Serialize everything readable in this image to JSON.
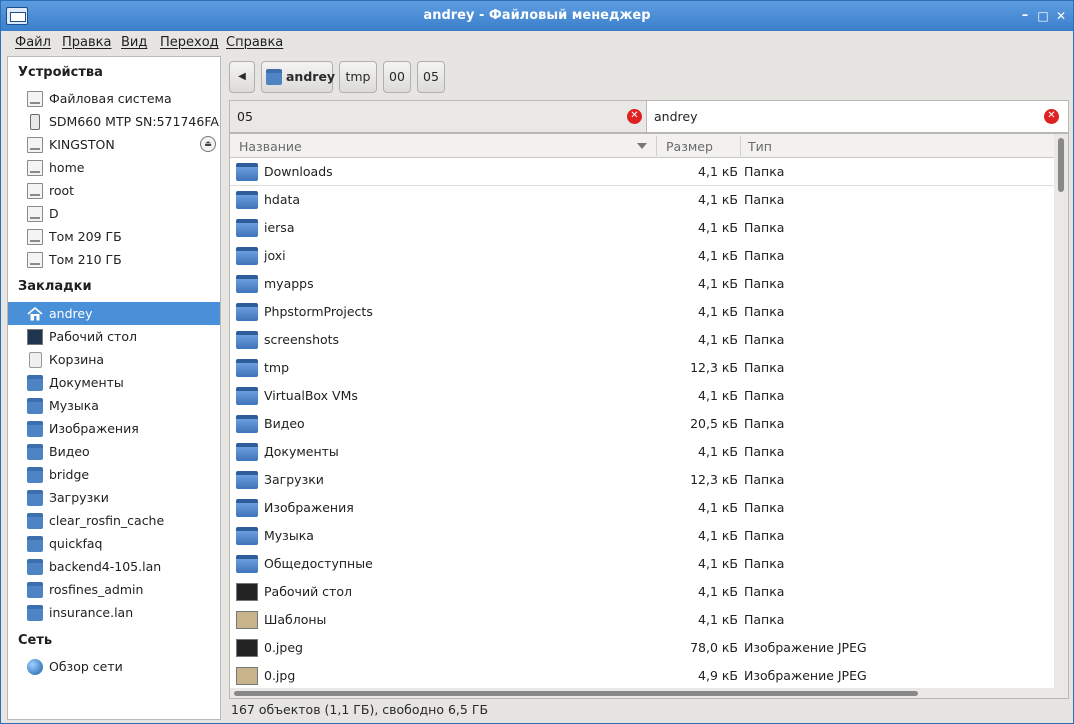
{
  "window": {
    "title": "andrey - Файловый менеджер",
    "controls": {
      "minimize": "–",
      "maximize": "□",
      "close": "✕"
    }
  },
  "menu": [
    "Файл",
    "Правка",
    "Вид",
    "Переход",
    "Справка"
  ],
  "sidebar": {
    "devices_title": "Устройства",
    "devices": [
      {
        "label": "Файловая система",
        "icon": "drive-icon"
      },
      {
        "label": "SDM660 MTP  SN:571746FA",
        "icon": "phone-icon"
      },
      {
        "label": "KINGSTON",
        "icon": "drive-icon",
        "eject": "⏏"
      },
      {
        "label": "home",
        "icon": "drive-icon"
      },
      {
        "label": "root",
        "icon": "drive-icon"
      },
      {
        "label": "D",
        "icon": "drive-icon"
      },
      {
        "label": "Том 209 ГБ",
        "icon": "drive-icon"
      },
      {
        "label": "Том 210 ГБ",
        "icon": "drive-icon"
      }
    ],
    "bookmarks_title": "Закладки",
    "bookmarks": [
      {
        "label": "andrey",
        "icon": "home-icon",
        "selected": true
      },
      {
        "label": "Рабочий стол",
        "icon": "desktop-icon"
      },
      {
        "label": "Корзина",
        "icon": "trash-icon"
      },
      {
        "label": "Документы",
        "icon": "folder-icon"
      },
      {
        "label": "Музыка",
        "icon": "folder-icon"
      },
      {
        "label": "Изображения",
        "icon": "folder-icon"
      },
      {
        "label": "Видео",
        "icon": "folder-icon"
      },
      {
        "label": "bridge",
        "icon": "folder-icon"
      },
      {
        "label": "Загрузки",
        "icon": "folder-icon"
      },
      {
        "label": "clear_rosfin_cache",
        "icon": "folder-icon"
      },
      {
        "label": "quickfaq",
        "icon": "folder-icon"
      },
      {
        "label": "backend4-105.lan",
        "icon": "folder-icon"
      },
      {
        "label": "rosfines_admin",
        "icon": "folder-icon"
      },
      {
        "label": "insurance.lan",
        "icon": "folder-icon"
      }
    ],
    "network_title": "Сеть",
    "network": [
      {
        "label": "Обзор сети",
        "icon": "globe-icon"
      }
    ]
  },
  "pathbar": {
    "back": "◀",
    "crumbs": [
      "andrey",
      "tmp",
      "00",
      "05"
    ]
  },
  "tabs": [
    {
      "label": "05",
      "close": "✕"
    },
    {
      "label": "andrey",
      "close": "✕"
    }
  ],
  "columns": {
    "name": "Название",
    "size": "Размер",
    "type": "Тип"
  },
  "files": [
    {
      "name": "Downloads",
      "size": "4,1 кБ",
      "type": "Папка",
      "icon": "folder-icon"
    },
    {
      "name": "hdata",
      "size": "4,1 кБ",
      "type": "Папка",
      "icon": "folder-icon"
    },
    {
      "name": "iersa",
      "size": "4,1 кБ",
      "type": "Папка",
      "icon": "folder-icon"
    },
    {
      "name": "joxi",
      "size": "4,1 кБ",
      "type": "Папка",
      "icon": "folder-icon"
    },
    {
      "name": "myapps",
      "size": "4,1 кБ",
      "type": "Папка",
      "icon": "folder-icon"
    },
    {
      "name": "PhpstormProjects",
      "size": "4,1 кБ",
      "type": "Папка",
      "icon": "folder-icon"
    },
    {
      "name": "screenshots",
      "size": "4,1 кБ",
      "type": "Папка",
      "icon": "folder-icon"
    },
    {
      "name": "tmp",
      "size": "12,3 кБ",
      "type": "Папка",
      "icon": "folder-icon"
    },
    {
      "name": "VirtualBox VMs",
      "size": "4,1 кБ",
      "type": "Папка",
      "icon": "folder-icon"
    },
    {
      "name": "Видео",
      "size": "20,5 кБ",
      "type": "Папка",
      "icon": "folder-video-icon"
    },
    {
      "name": "Документы",
      "size": "4,1 кБ",
      "type": "Папка",
      "icon": "folder-documents-icon"
    },
    {
      "name": "Загрузки",
      "size": "12,3 кБ",
      "type": "Папка",
      "icon": "folder-downloads-icon"
    },
    {
      "name": "Изображения",
      "size": "4,1 кБ",
      "type": "Папка",
      "icon": "folder-pictures-icon"
    },
    {
      "name": "Музыка",
      "size": "4,1 кБ",
      "type": "Папка",
      "icon": "folder-music-icon"
    },
    {
      "name": "Общедоступные",
      "size": "4,1 кБ",
      "type": "Папка",
      "icon": "folder-public-icon"
    },
    {
      "name": "Рабочий стол",
      "size": "4,1 кБ",
      "type": "Папка",
      "icon": "desktop-icon"
    },
    {
      "name": "Шаблоны",
      "size": "4,1 кБ",
      "type": "Папка",
      "icon": "folder-templates-icon"
    },
    {
      "name": "0.jpeg",
      "size": "78,0 кБ",
      "type": "Изображение JPEG",
      "icon": "image-thumbnail-icon"
    },
    {
      "name": "0.jpg",
      "size": "4,9 кБ",
      "type": "Изображение JPEG",
      "icon": "image-thumbnail-icon"
    }
  ],
  "status": "167 объектов (1,1 ГБ), свободно 6,5 ГБ",
  "colors": {
    "accent": "#4a90d9",
    "titlebar": "#3b7fcb",
    "folder": "#4f84c4"
  }
}
